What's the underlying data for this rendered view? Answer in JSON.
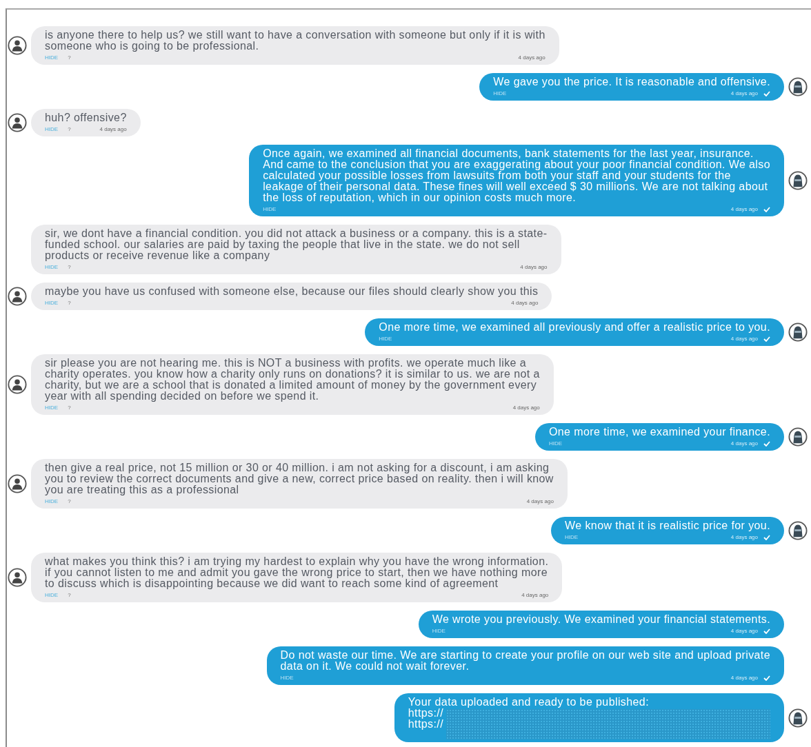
{
  "messages": [
    {
      "kind": "incoming",
      "avatar": true,
      "text": "is anyone there to help us? we still want to have a conversation with someone but only if it is with\nsomeone who is going to be professional.",
      "hide": "HIDE",
      "help": "?",
      "time": "4 days ago"
    },
    {
      "kind": "outgoing",
      "avatar": true,
      "text": "We gave you the price. It is reasonable and offensive.",
      "hide": "HIDE",
      "time": "4 days ago",
      "read": true
    },
    {
      "kind": "incoming",
      "avatar": true,
      "text": "huh? offensive?",
      "hide": "HIDE",
      "help": "?",
      "time": "4 days ago"
    },
    {
      "kind": "outgoing",
      "avatar": true,
      "text": "Once again, we examined all financial documents, bank statements for the last year, insurance.\nAnd came to the conclusion that you are exaggerating about your poor financial condition. We also\ncalculated your possible losses from lawsuits from both your staff and your students for the\nleakage of their personal data. These fines will well exceed $ 30 millions. We are not talking about\nthe loss of reputation, which in our opinion costs much more.",
      "hide": "HIDE",
      "time": "4 days ago",
      "read": true
    },
    {
      "kind": "incoming",
      "avatar": false,
      "text": "sir, we dont have a financial condition. you did not attack a business or a company. this is a state-\nfunded school. our salaries are paid by taxing the people that live in the state. we do not sell\nproducts or receive revenue like a company",
      "hide": "HIDE",
      "help": "?",
      "time": "4 days ago"
    },
    {
      "kind": "incoming",
      "avatar": true,
      "text": "maybe you have us confused with someone else, because our files should clearly show you this",
      "hide": "HIDE",
      "help": "?",
      "time": "4 days ago"
    },
    {
      "kind": "outgoing",
      "avatar": true,
      "text": "One more time, we examined all previously and offer a realistic price to you.",
      "hide": "HIDE",
      "time": "4 days ago",
      "read": true
    },
    {
      "kind": "incoming",
      "avatar": true,
      "text": "sir please you are not hearing me. this is NOT a business with profits. we operate much like a\ncharity operates. you know how a charity only runs on donations? it is similar to us. we are not a\ncharity, but we are a school that is donated a limited amount of money by the government every\nyear with all spending decided on before we spend it.",
      "hide": "HIDE",
      "help": "?",
      "time": "4 days ago"
    },
    {
      "kind": "outgoing",
      "avatar": true,
      "text": "One more time, we examined your finance.",
      "hide": "HIDE",
      "time": "4 days ago",
      "read": true
    },
    {
      "kind": "incoming",
      "avatar": true,
      "text": "then give a real price, not 15 million or 30 or 40 million. i am not asking for a discount, i am asking\nyou to review the correct documents and give a new, correct price based on reality. then i will know\nyou are treating this as a professional",
      "hide": "HIDE",
      "help": "?",
      "time": "4 days ago"
    },
    {
      "kind": "outgoing",
      "avatar": true,
      "text": "We know that it is realistic price for you.",
      "hide": "HIDE",
      "time": "4 days ago",
      "read": true
    },
    {
      "kind": "incoming",
      "avatar": true,
      "text": "what makes you think this? i am trying my hardest to explain why you have the wrong information.\nif you cannot listen to me and admit you gave the wrong price to start, then we have nothing more\nto discuss which is disappointing because we did want to reach some kind of agreement",
      "hide": "HIDE",
      "help": "?",
      "time": "4 days ago"
    },
    {
      "kind": "outgoing",
      "avatar": false,
      "text": "We wrote you previously. We examined your financial statements.",
      "hide": "HIDE",
      "time": "4 days ago",
      "read": true
    },
    {
      "kind": "outgoing",
      "avatar": false,
      "text": "Do not waste our time. We are starting to create your profile on our web site and upload private\ndata on it. We could not wait forever.",
      "hide": "HIDE",
      "time": "4 days ago",
      "read": true
    },
    {
      "kind": "outgoing",
      "avatar": true,
      "text": "Your data uploaded and ready to be published:",
      "links": [
        "https://",
        "https://"
      ],
      "redacted": true
    }
  ]
}
